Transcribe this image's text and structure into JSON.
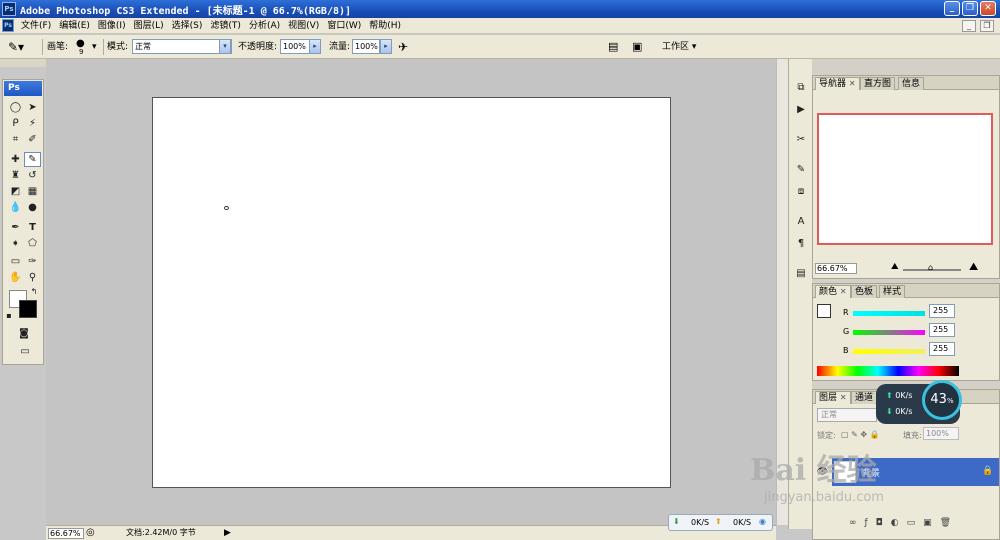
{
  "window": {
    "title": "Adobe Photoshop CS3 Extended - [未标题-1 @ 66.7%(RGB/8)]",
    "app_icon": "Ps",
    "controls": [
      "minimize-icon",
      "restore-icon",
      "close-icon"
    ]
  },
  "menu": {
    "items": [
      "文件(F)",
      "编辑(E)",
      "图像(I)",
      "图层(L)",
      "选择(S)",
      "滤镜(T)",
      "分析(A)",
      "视图(V)",
      "窗口(W)",
      "帮助(H)"
    ]
  },
  "options": {
    "brush_label": "画笔:",
    "brush_size": "9",
    "mode_label": "模式:",
    "mode_value": "正常",
    "opacity_label": "不透明度:",
    "opacity_value": "100%",
    "flow_label": "流量:",
    "flow_value": "100%",
    "workspace_label": "工作区 ▾"
  },
  "tools": {
    "header": "Ps",
    "items": [
      "marquee-icon",
      "move-icon",
      "lasso-icon",
      "magic-wand-icon",
      "crop-icon",
      "slice-icon",
      "healing-brush-icon",
      "brush-icon",
      "clone-stamp-icon",
      "history-brush-icon",
      "eraser-icon",
      "gradient-icon",
      "blur-icon",
      "dodge-icon",
      "pen-icon",
      "type-icon",
      "path-selection-icon",
      "shape-icon",
      "notes-icon",
      "eyedropper-icon",
      "hand-icon",
      "zoom-icon"
    ],
    "foreground_color": "#ffffff",
    "background_color": "#000000"
  },
  "document": {
    "background": "#ffffff",
    "zoom": "66.67%",
    "doc_info": "文档:2.42M/0 字节"
  },
  "navigator": {
    "tabs": [
      "导航器",
      "直方图",
      "信息"
    ],
    "zoom": "66.67%",
    "view_box_color": "#e05a5a"
  },
  "color": {
    "tabs": [
      "颜色",
      "色板",
      "样式"
    ],
    "channels": [
      {
        "label": "R",
        "value": "255",
        "color": "#00c8c8"
      },
      {
        "label": "G",
        "value": "255",
        "color": "#e040e0"
      },
      {
        "label": "B",
        "value": "255",
        "color": "#e0e040"
      }
    ]
  },
  "layers": {
    "tabs": [
      "图层",
      "通道"
    ],
    "blend_mode": "正常",
    "lock_label": "锁定:",
    "fill_label": "填充:",
    "fill_value": "100%",
    "layer_name": "背景"
  },
  "network": {
    "up_speed": "0K/s",
    "down_speed": "0K/s",
    "percent": "43",
    "percent_unit": "%",
    "bottom_down": "0K/S",
    "bottom_up": "0K/S"
  },
  "watermark": {
    "logo": "Bai 经验",
    "url": "jingyan.baidu.com"
  }
}
